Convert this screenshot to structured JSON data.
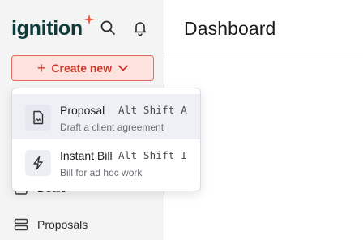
{
  "brand": {
    "name": "ignition",
    "accent": "#e8533f",
    "text_color": "#0e3b3a"
  },
  "header": {
    "search_icon": "search-icon",
    "notifications_icon": "bell-icon"
  },
  "create_button": {
    "label": "Create new",
    "plus": "+",
    "icon": "chevron-down-icon"
  },
  "create_menu": {
    "items": [
      {
        "title": "Proposal",
        "subtitle": "Draft a client agreement",
        "shortcut": "Alt Shift A",
        "icon": "document-signature-icon"
      },
      {
        "title": "Instant Bill",
        "subtitle": "Bill for ad hoc work",
        "shortcut": "Alt Shift I",
        "icon": "lightning-icon"
      }
    ]
  },
  "sidebar": {
    "items": [
      {
        "label": "Deals",
        "icon": "deals-icon"
      },
      {
        "label": "Proposals",
        "icon": "proposals-icon"
      }
    ]
  },
  "main": {
    "title": "Dashboard"
  }
}
